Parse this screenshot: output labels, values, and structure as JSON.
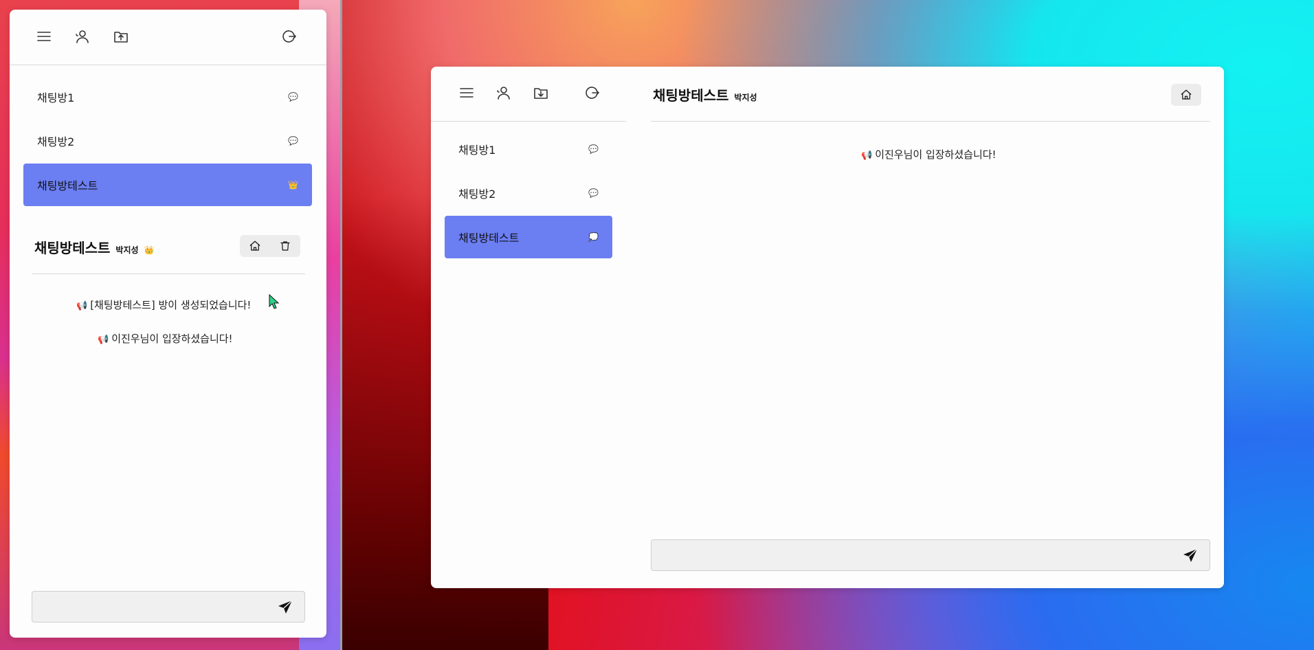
{
  "left_window": {
    "toolbar": [
      "menu-icon",
      "friends-icon",
      "folder-upload-icon",
      "logout-icon"
    ],
    "rooms": [
      {
        "label": "채팅방1",
        "emoji": "💬",
        "active": false
      },
      {
        "label": "채팅방2",
        "emoji": "💬",
        "active": false
      },
      {
        "label": "채팅방테스트",
        "emoji": "👑",
        "active": true
      }
    ],
    "chat": {
      "title": "채팅방테스트",
      "owner": "박지성",
      "owner_emoji": "👑",
      "messages": [
        {
          "icon": "📢",
          "text": "[채팅방테스트] 방이 생성되었습니다!"
        },
        {
          "icon": "📢",
          "text": "이진우님이 입장하셨습니다!"
        }
      ],
      "input_placeholder": ""
    }
  },
  "right_window": {
    "toolbar": [
      "menu-icon",
      "friends-icon",
      "folder-download-icon",
      "logout-icon"
    ],
    "rooms": [
      {
        "label": "채팅방1",
        "emoji": "💬",
        "active": false
      },
      {
        "label": "채팅방2",
        "emoji": "💬",
        "active": false
      },
      {
        "label": "채팅방테스트",
        "emoji": "💭",
        "active": true
      }
    ],
    "chat": {
      "title": "채팅방테스트",
      "owner": "박지성",
      "messages": [
        {
          "icon": "📢",
          "text": "이진우님이 입장하셨습니다!"
        }
      ],
      "input_placeholder": ""
    }
  },
  "colors": {
    "active_room": "#6b7ef2",
    "window_bg": "#fdfdfd"
  }
}
